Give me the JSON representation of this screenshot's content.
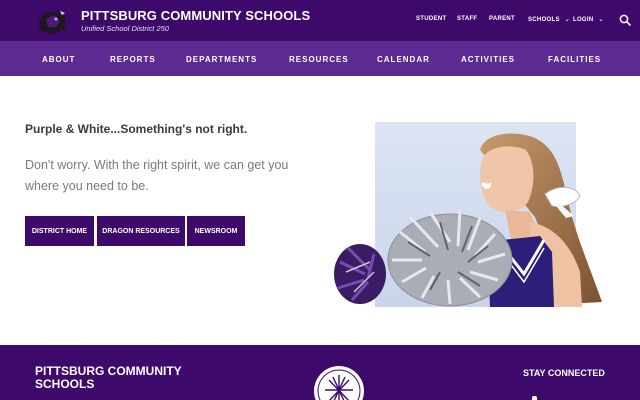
{
  "header": {
    "title": "PITTSBURG COMMUNITY SCHOOLS",
    "subtitle": "Unified School District 250",
    "utility_links": [
      {
        "label": "STUDENT"
      },
      {
        "label": "STAFF"
      },
      {
        "label": "PARENT"
      },
      {
        "label": "SCHOOLS",
        "icon": "chevron-down-icon"
      },
      {
        "label": "LOGIN",
        "icon": "chevron-down-icon"
      }
    ],
    "search_icon": "search-icon"
  },
  "nav": {
    "items": [
      {
        "label": "ABOUT"
      },
      {
        "label": "REPORTS"
      },
      {
        "label": "DEPARTMENTS"
      },
      {
        "label": "RESOURCES"
      },
      {
        "label": "CALENDAR"
      },
      {
        "label": "ACTIVITIES"
      },
      {
        "label": "FACILITIES"
      }
    ]
  },
  "hero": {
    "headline": "Purple & White...Something's not right.",
    "message": "Don't worry.  With the right spirit, we can get you where you need to be.",
    "buttons": [
      {
        "label": "DISTRICT HOME"
      },
      {
        "label": "DRAGON RESOURCES"
      },
      {
        "label": "NEWSROOM"
      }
    ]
  },
  "footer": {
    "name": "PITTSBURG COMMUNITY SCHOOLS",
    "stay_connected": "STAY CONNECTED"
  },
  "colors": {
    "header_bg": "#3d0a6b",
    "nav_bg": "#5d2a91",
    "button_bg": "#3d0a6b",
    "footer_bg": "#3d0a6b"
  }
}
